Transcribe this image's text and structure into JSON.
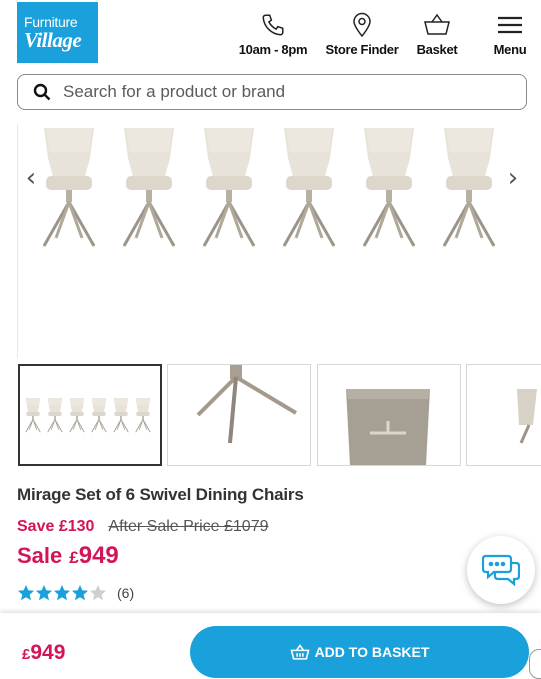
{
  "brand": {
    "logo_line1": "Furniture",
    "logo_line2": "Village"
  },
  "header": {
    "hours_label": "10am - 8pm",
    "store_finder_label": "Store Finder",
    "basket_label": "Basket",
    "menu_label": "Menu"
  },
  "search": {
    "placeholder": "Search for a product or brand"
  },
  "gallery": {
    "prev_arrow": "‹",
    "next_arrow": "›"
  },
  "product": {
    "title": "Mirage Set of 6 Swivel Dining Chairs",
    "save_text": "Save £130",
    "after_sale_text": "After Sale Price £1079",
    "sale_word": "Sale",
    "currency": "£",
    "price": "949",
    "rating": 4.5,
    "rating_count": "(6)"
  },
  "bottom_bar": {
    "currency": "£",
    "price": "949",
    "add_to_basket_label": "ADD TO BASKET"
  },
  "colors": {
    "brand_blue": "#1aa1dc",
    "sale_red": "#d4145a",
    "star_blue": "#1aa1dc"
  }
}
